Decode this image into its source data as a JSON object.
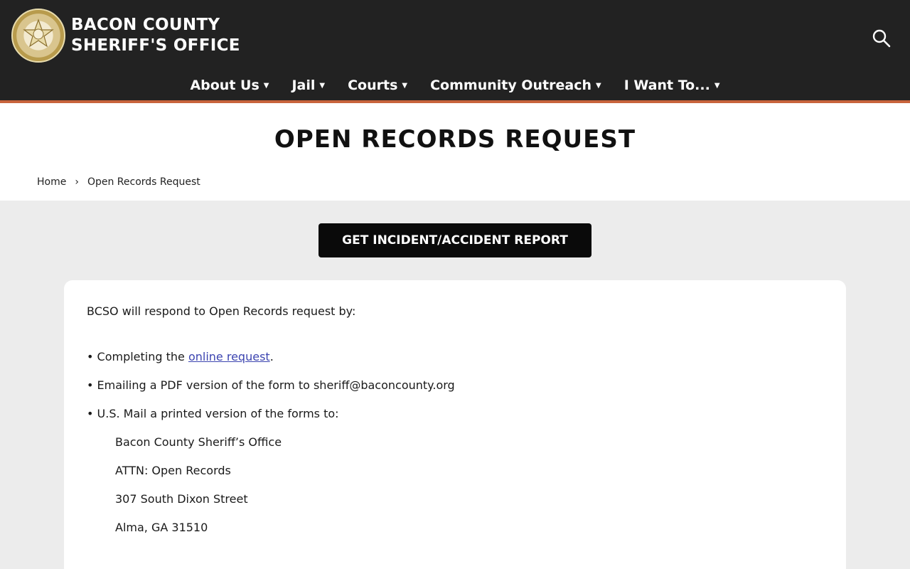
{
  "header": {
    "site_name_line1": "BACON COUNTY",
    "site_name_line2": "SHERIFF'S OFFICE",
    "logo_icon": "sheriff-star-badge",
    "search_icon": "search-icon",
    "accent_color": "#c8643c",
    "background_color": "#222222"
  },
  "nav": {
    "items": [
      {
        "label": "About Us"
      },
      {
        "label": "Jail"
      },
      {
        "label": "Courts"
      },
      {
        "label": "Community Outreach"
      },
      {
        "label": "I Want To..."
      }
    ]
  },
  "page": {
    "title": "OPEN RECORDS REQUEST",
    "breadcrumb": {
      "home": "Home",
      "current": "Open Records Request"
    },
    "cta_label": "GET INCIDENT/ACCIDENT REPORT"
  },
  "content": {
    "intro": "BCSO will respond to Open Records request by:",
    "bullet1_prefix": "• Completing the ",
    "bullet1_link": "online request",
    "bullet1_suffix": ".",
    "bullet2": "• Emailing a PDF version of the form to sheriff@baconcounty.org",
    "bullet3": "• U.S. Mail a printed version of the forms to:",
    "address": [
      "Bacon County Sheriff’s Office",
      "ATTN: Open Records",
      "307 South Dixon Street",
      "Alma, GA 31510"
    ],
    "link_color": "#3c44b0"
  }
}
